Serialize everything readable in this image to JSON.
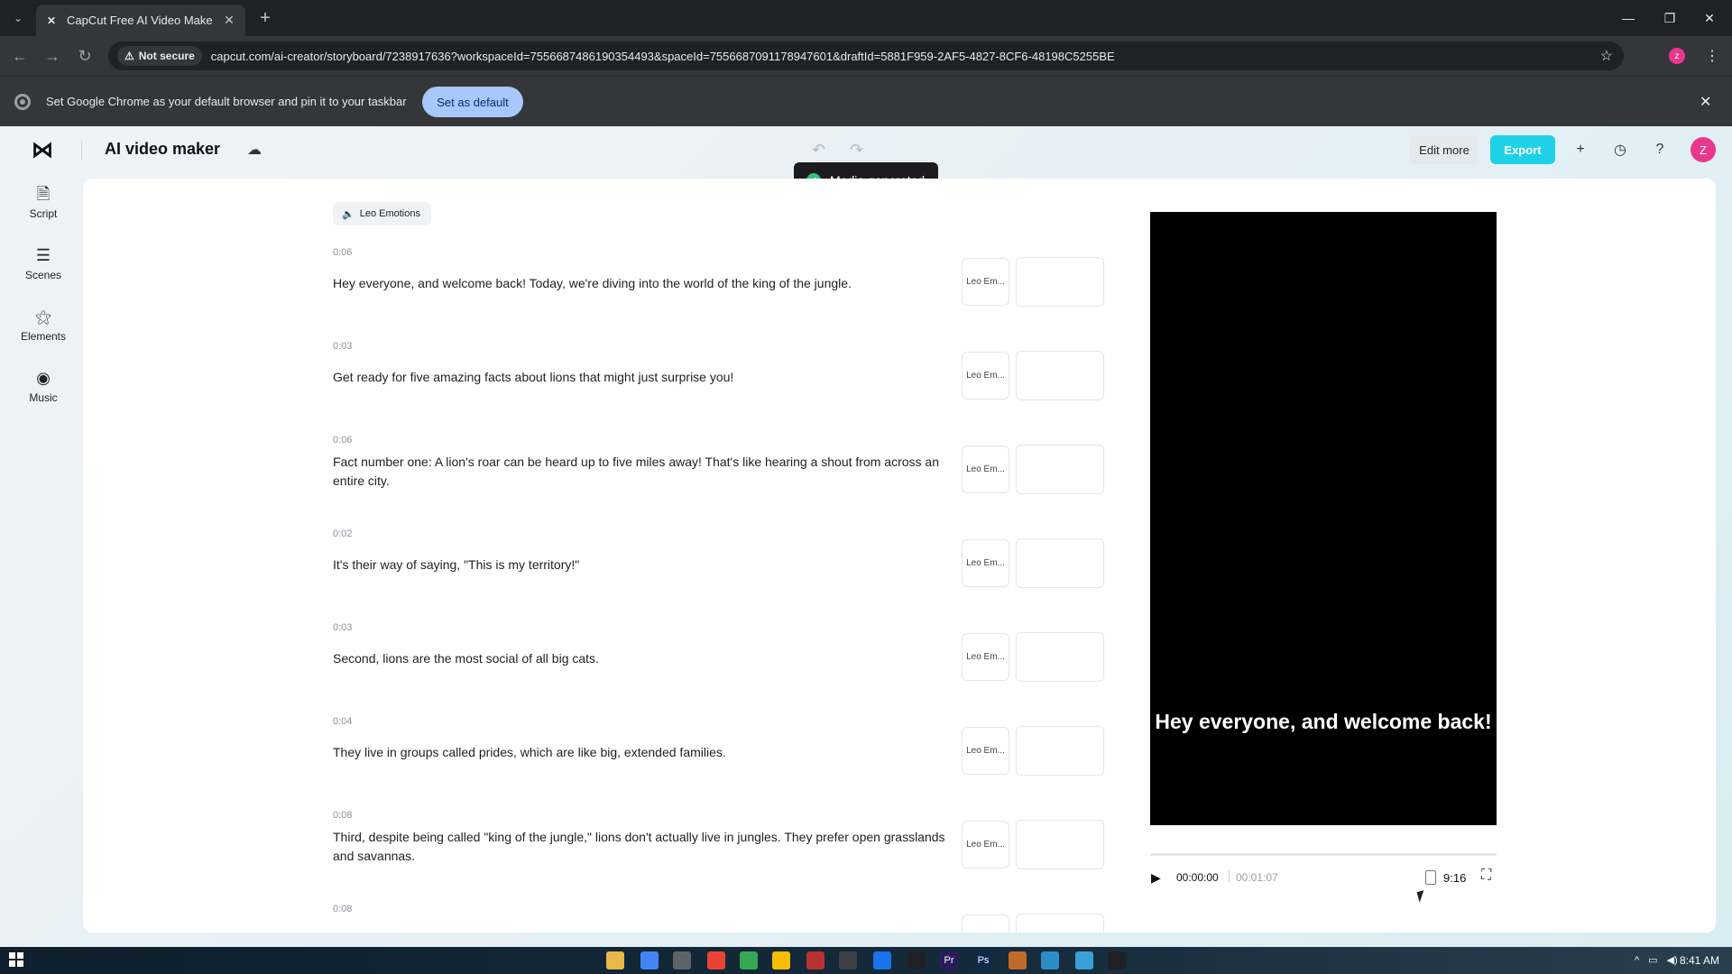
{
  "browser": {
    "tab_title": "CapCut Free AI Video Maker | S",
    "security_label": "Not secure",
    "url": "capcut.com/ai-creator/storyboard/7238917636?workspaceId=7556687486190354493&spaceId=7556687091178947601&draftId=5881F959-2AF5-4827-8CF6-48198C5255BE",
    "profile_initial": "z",
    "infobar_text": "Set Google Chrome as your default browser and pin it to your taskbar",
    "infobar_button": "Set as default"
  },
  "app": {
    "title": "AI video maker",
    "edit_more_label": "Edit more",
    "export_label": "Export",
    "user_initial": "Z",
    "accent_color": "#1fd1e6",
    "toast_text": "Media generated"
  },
  "rail": {
    "items": [
      {
        "label": "Script",
        "icon": "script-icon"
      },
      {
        "label": "Scenes",
        "icon": "scenes-icon"
      },
      {
        "label": "Elements",
        "icon": "elements-icon"
      },
      {
        "label": "Music",
        "icon": "music-icon"
      }
    ]
  },
  "script": {
    "voice_chip": "Leo Emotions",
    "scenes": [
      {
        "time": "0:06",
        "text": "Hey everyone, and welcome back! Today, we're diving into the world of the king of the jungle.",
        "voice": "Leo Em..."
      },
      {
        "time": "0:03",
        "text": "Get ready for five amazing facts about lions that might just surprise you!",
        "voice": "Leo Em..."
      },
      {
        "time": "0:06",
        "text": "Fact number one: A lion's roar can be heard up to five miles away! That's like hearing a shout from across an entire city.",
        "voice": "Leo Em..."
      },
      {
        "time": "0:02",
        "text": "It's their way of saying, \"This is my territory!\"",
        "voice": "Leo Em..."
      },
      {
        "time": "0:03",
        "text": "Second, lions are the most social of all big cats.",
        "voice": "Leo Em..."
      },
      {
        "time": "0:04",
        "text": "They live in groups called prides, which are like big, extended families.",
        "voice": "Leo Em..."
      },
      {
        "time": "0:08",
        "text": "Third, despite being called \"king of the jungle,\" lions don't actually live in jungles. They prefer open grasslands and savannas.",
        "voice": "Leo Em..."
      },
      {
        "time": "0:08",
        "text": "",
        "voice": ""
      }
    ]
  },
  "preview": {
    "caption": "Hey everyone, and welcome back!",
    "current_time": "00:00:00",
    "total_time": "00:01:07",
    "aspect_ratio": "9:16",
    "progress": 0
  },
  "taskbar": {
    "clock": "8:41 AM"
  }
}
